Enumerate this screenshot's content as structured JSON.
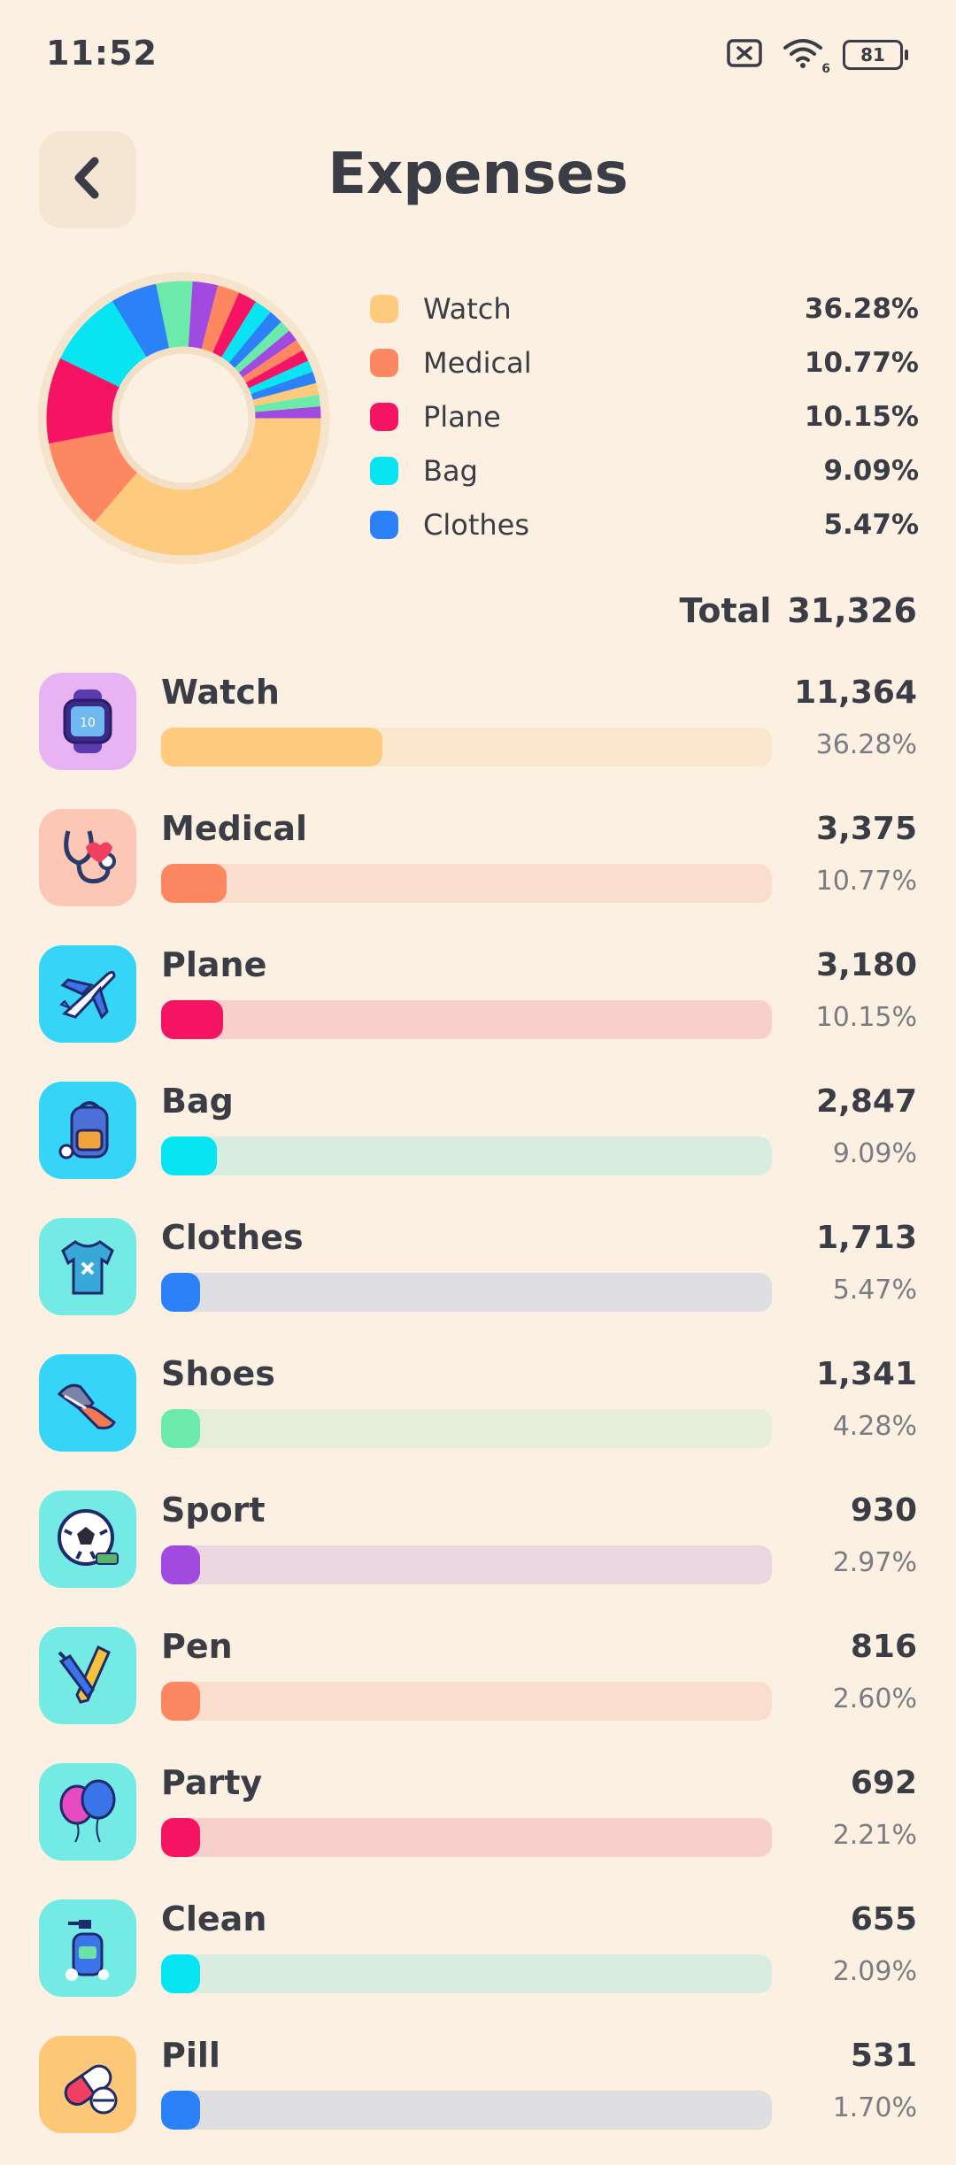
{
  "status": {
    "time": "11:52",
    "battery": "81",
    "signal_sub": "6"
  },
  "header": {
    "title": "Expenses"
  },
  "legend": [
    {
      "label": "Watch",
      "pct": "36.28%",
      "color": "#fecb7e"
    },
    {
      "label": "Medical",
      "pct": "10.77%",
      "color": "#fd8760"
    },
    {
      "label": "Plane",
      "pct": "10.15%",
      "color": "#f51463"
    },
    {
      "label": "Bag",
      "pct": "9.09%",
      "color": "#07e5f2"
    },
    {
      "label": "Clothes",
      "pct": "5.47%",
      "color": "#2b81f7"
    }
  ],
  "total": {
    "label": "Total",
    "value": "31,326"
  },
  "items": [
    {
      "name": "Watch",
      "amount": "11,364",
      "pct": "36.28%",
      "ratio": 0.3628,
      "color": "#fecb7e",
      "track": "#fae5cd",
      "icon_bg": "#e7b3f2",
      "icon": "watch-icon"
    },
    {
      "name": "Medical",
      "amount": "3,375",
      "pct": "10.77%",
      "ratio": 0.1077,
      "color": "#fd8760",
      "track": "#f9ddcd",
      "icon_bg": "#fcc7b4",
      "icon": "stethoscope-icon"
    },
    {
      "name": "Plane",
      "amount": "3,180",
      "pct": "10.15%",
      "ratio": 0.1015,
      "color": "#f51463",
      "track": "#f8cfcb",
      "icon_bg": "#36d5f8",
      "icon": "plane-icon"
    },
    {
      "name": "Bag",
      "amount": "2,847",
      "pct": "9.09%",
      "ratio": 0.0909,
      "color": "#07e5f2",
      "track": "#d8ecdf",
      "icon_bg": "#36d5f8",
      "icon": "backpack-icon"
    },
    {
      "name": "Clothes",
      "amount": "1,713",
      "pct": "5.47%",
      "ratio": 0.0547,
      "color": "#2b81f7",
      "track": "#dfdfe3",
      "icon_bg": "#73ebe4",
      "icon": "tshirt-icon"
    },
    {
      "name": "Shoes",
      "amount": "1,341",
      "pct": "4.28%",
      "ratio": 0.0428,
      "color": "#6beaa9",
      "track": "#e5eed8",
      "icon_bg": "#36d5f8",
      "icon": "shoes-icon"
    },
    {
      "name": "Sport",
      "amount": "930",
      "pct": "2.97%",
      "ratio": 0.0297,
      "color": "#a14adf",
      "track": "#ebd7df",
      "icon_bg": "#73ebe4",
      "icon": "soccer-ball-icon"
    },
    {
      "name": "Pen",
      "amount": "816",
      "pct": "2.60%",
      "ratio": 0.026,
      "color": "#fd8760",
      "track": "#f9ddcd",
      "icon_bg": "#73ebe4",
      "icon": "pencil-icon"
    },
    {
      "name": "Party",
      "amount": "692",
      "pct": "2.21%",
      "ratio": 0.0221,
      "color": "#f51463",
      "track": "#f8cfcb",
      "icon_bg": "#73ebe4",
      "icon": "balloons-icon"
    },
    {
      "name": "Clean",
      "amount": "655",
      "pct": "2.09%",
      "ratio": 0.0209,
      "color": "#07e5f2",
      "track": "#d8ecdf",
      "icon_bg": "#73ebe4",
      "icon": "soap-bottle-icon"
    },
    {
      "name": "Pill",
      "amount": "531",
      "pct": "1.70%",
      "ratio": 0.017,
      "color": "#2b81f7",
      "track": "#dfdfe3",
      "icon_bg": "#fdc778",
      "icon": "pill-icon"
    }
  ],
  "chart_data": {
    "type": "pie",
    "categories": [
      "Watch",
      "Medical",
      "Plane",
      "Bag",
      "Clothes",
      "Shoes",
      "Sport",
      "Pen",
      "Party",
      "Clean",
      "Pill"
    ],
    "values": [
      36.28,
      10.77,
      10.15,
      9.09,
      5.47,
      4.28,
      2.97,
      2.6,
      2.21,
      2.09,
      1.7
    ],
    "colors": [
      "#fecb7e",
      "#fd8760",
      "#f51463",
      "#07e5f2",
      "#2b81f7",
      "#6beaa9",
      "#a14adf",
      "#fd8760",
      "#f51463",
      "#07e5f2",
      "#2b81f7"
    ],
    "remaining_colors": [
      "#6beaa9",
      "#a14adf",
      "#fd8760",
      "#f51463",
      "#07e5f2",
      "#2b81f7",
      "#fecb7e"
    ]
  }
}
